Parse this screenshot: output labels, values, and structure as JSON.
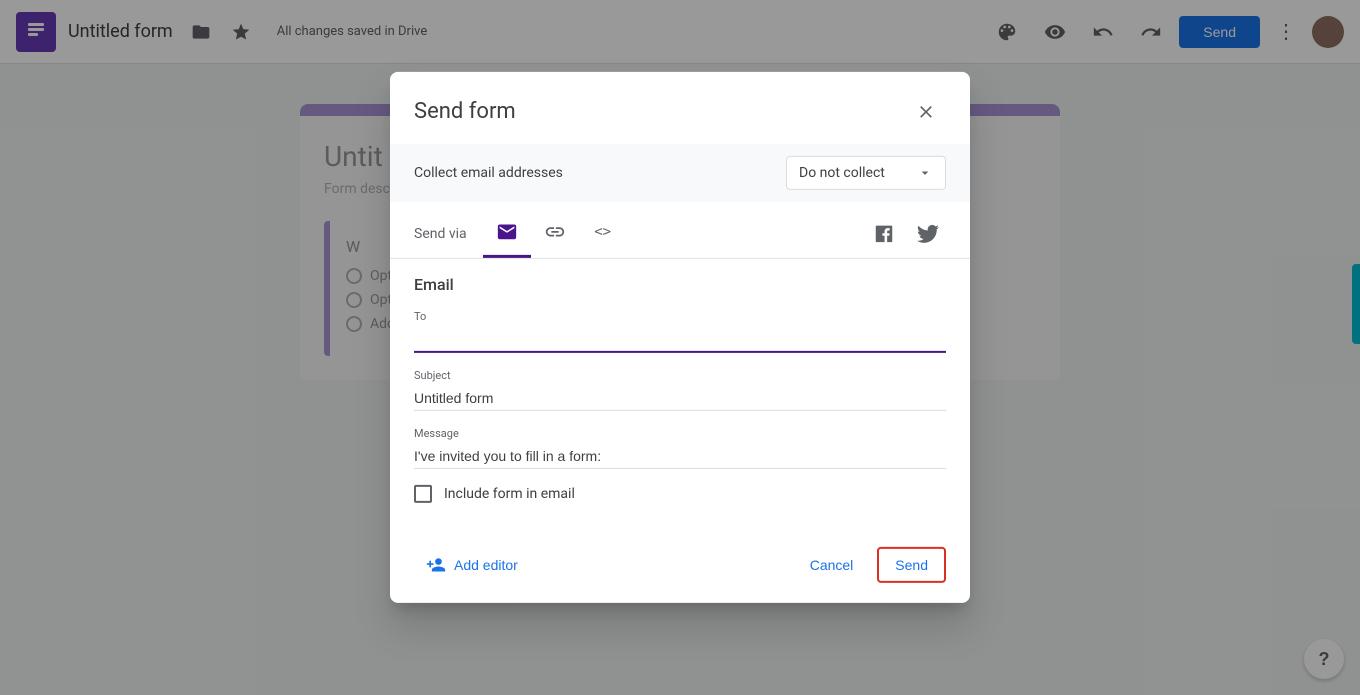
{
  "app": {
    "title": "Untitled form",
    "saved_text": "All changes saved in Drive"
  },
  "toolbar": {
    "send_button_label": "Send",
    "more_icon": "⋮"
  },
  "form_bg": {
    "title": "Untit",
    "description": "Form desc",
    "question_letter": "W",
    "options": [
      "Optio",
      "Optio",
      "Add o"
    ]
  },
  "dialog": {
    "title": "Send form",
    "close_icon": "✕",
    "collect_label": "Collect email addresses",
    "collect_value": "Do not collect",
    "send_via_label": "Send via",
    "tabs": [
      {
        "id": "email",
        "icon": "✉",
        "active": true
      },
      {
        "id": "link",
        "icon": "🔗",
        "active": false
      },
      {
        "id": "embed",
        "icon": "<>",
        "active": false
      }
    ],
    "social": {
      "facebook_label": "f",
      "twitter_label": "t"
    },
    "email_section": {
      "title": "Email",
      "to_label": "To",
      "to_value": "",
      "subject_label": "Subject",
      "subject_value": "Untitled form",
      "message_label": "Message",
      "message_value": "I've invited you to fill in a form:",
      "include_form_label": "Include form in email"
    },
    "footer": {
      "add_editor_label": "Add editor",
      "cancel_label": "Cancel",
      "send_label": "Send"
    }
  },
  "help": {
    "icon": "?"
  }
}
